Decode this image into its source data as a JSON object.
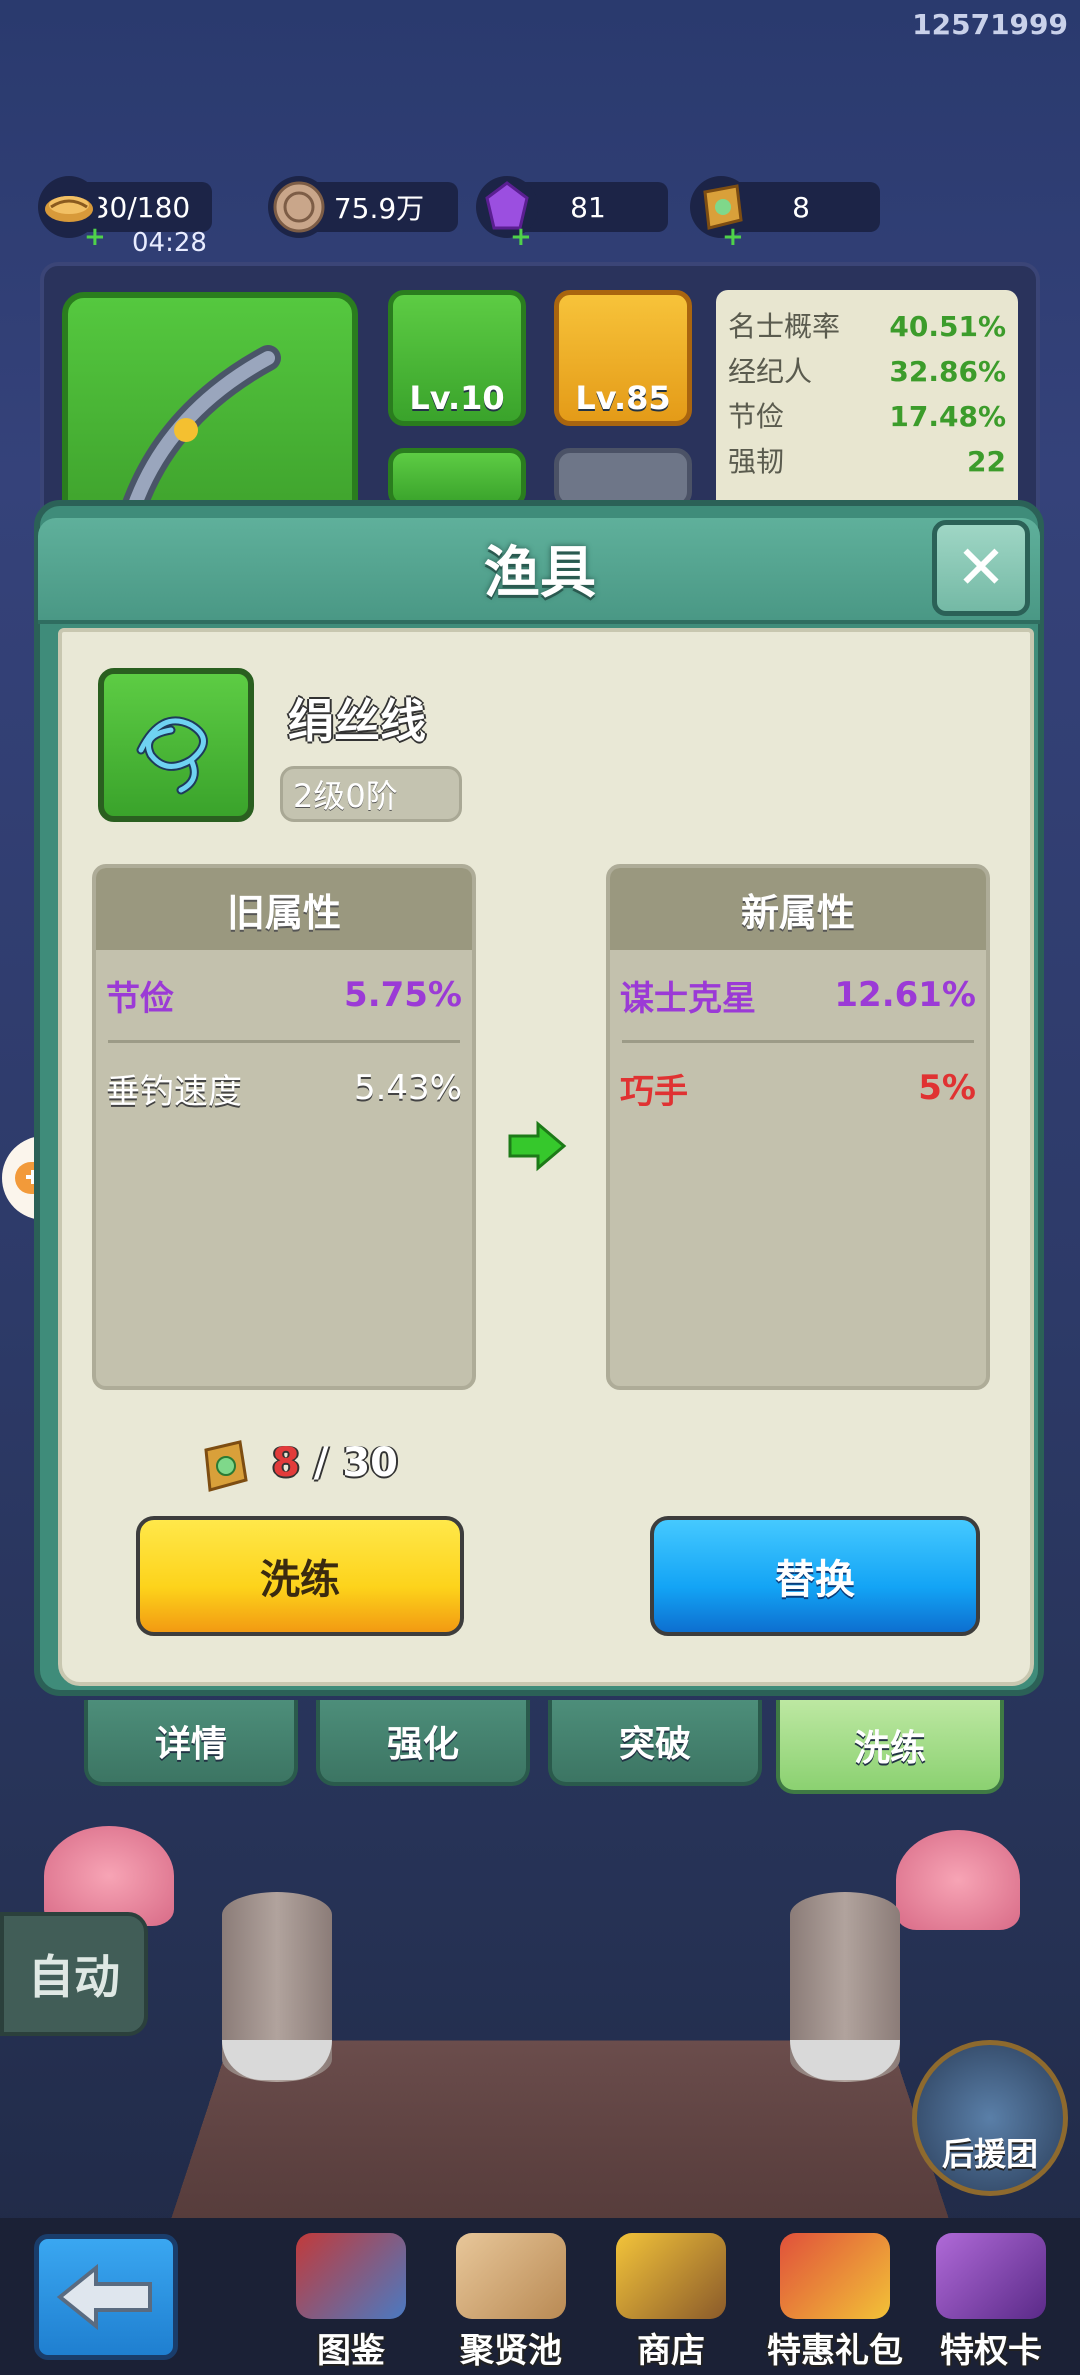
{
  "user_id": "12571999",
  "resources": {
    "stamina": {
      "value": "30/180",
      "timer": "04:28",
      "icon": "fish-bundle-icon"
    },
    "coins": {
      "value": "75.9万",
      "icon": "coin-icon"
    },
    "gems": {
      "value": "81",
      "icon": "purple-gem-icon"
    },
    "stones": {
      "value": "8",
      "icon": "refine-stone-icon"
    }
  },
  "equipment": {
    "slots": [
      {
        "label": "Lv.10",
        "icon": "rope-icon"
      },
      {
        "label": "Lv.85",
        "icon": "lure-icon"
      }
    ],
    "stats": [
      {
        "name": "名士概率",
        "value": "40.51%"
      },
      {
        "name": "经纪人",
        "value": "32.86%"
      },
      {
        "name": "节俭",
        "value": "17.48%"
      },
      {
        "name": "强韧",
        "value": "22"
      }
    ]
  },
  "modal": {
    "title": "渔具",
    "item_name": "绢丝线",
    "item_level": "2级0阶",
    "old_attrs": {
      "header": "旧属性",
      "rows": [
        {
          "name": "节俭",
          "value": "5.75%"
        },
        {
          "name": "垂钓速度",
          "value": "5.43%"
        }
      ]
    },
    "new_attrs": {
      "header": "新属性",
      "rows": [
        {
          "name": "谋士克星",
          "value": "12.61%"
        },
        {
          "name": "巧手",
          "value": "5%"
        }
      ]
    },
    "cost": {
      "current": "8",
      "separator": " / ",
      "total": "30"
    },
    "refine_button": "洗练",
    "replace_button": "替换"
  },
  "tabs": [
    {
      "label": "详情"
    },
    {
      "label": "强化"
    },
    {
      "label": "突破"
    },
    {
      "label": "洗练",
      "active": true
    }
  ],
  "scene": {
    "auto_button": "自动",
    "support_label": "后援团"
  },
  "bottom_nav": [
    {
      "label": "图鉴",
      "icon": "book-icon"
    },
    {
      "label": "聚贤池",
      "icon": "scroll-icon"
    },
    {
      "label": "商店",
      "icon": "shop-icon"
    },
    {
      "label": "特惠礼包",
      "icon": "gift-pack-icon"
    },
    {
      "label": "特权卡",
      "icon": "privilege-card-icon"
    }
  ],
  "colors": {
    "purple_stat": "#9b3ad6",
    "red_stat": "#e03232",
    "green_stat": "#3c9c2b",
    "modal_teal": "#3f8c7a"
  }
}
